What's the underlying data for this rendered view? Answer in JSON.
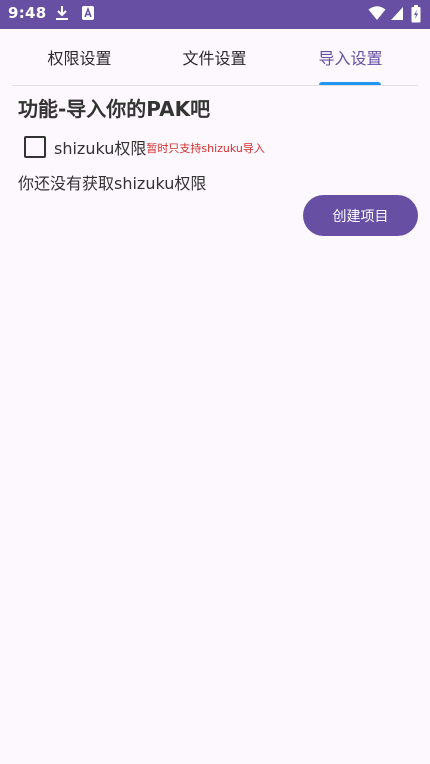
{
  "status_bar": {
    "time": "9:48",
    "icons": [
      "download-icon",
      "a-app-icon",
      "wifi-icon",
      "signal-icon",
      "battery-icon"
    ],
    "bg_color": "#6750a4"
  },
  "tabs": [
    {
      "label": "权限设置",
      "active": false
    },
    {
      "label": "文件设置",
      "active": false
    },
    {
      "label": "导入设置",
      "active": true
    }
  ],
  "main": {
    "title": "功能-导入你的PAK吧",
    "shizuku_checkbox": {
      "label": "shizuku权限",
      "note": "暂时只支持shizuku导入",
      "checked": false
    },
    "status_text": "你还没有获取shizuku权限",
    "create_button_label": "创建项目"
  },
  "colors": {
    "accent": "#6750a4",
    "indicator": "#2196f3",
    "note": "#d32f2f"
  }
}
